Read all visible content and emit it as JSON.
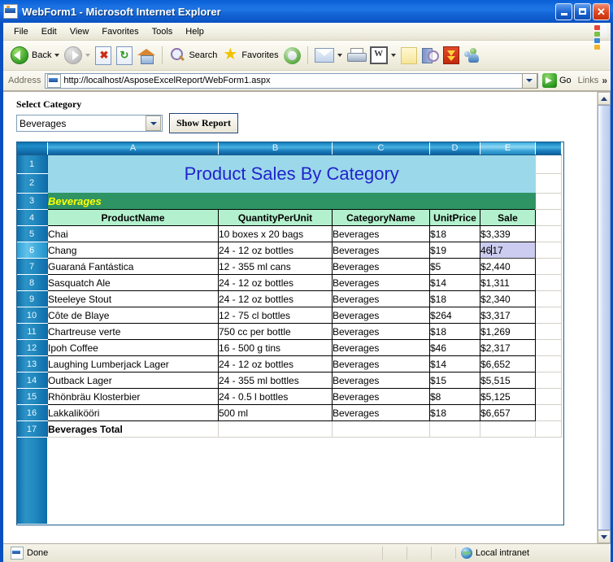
{
  "window": {
    "title": "WebForm1 - Microsoft Internet Explorer",
    "icon": "ie-document-icon",
    "buttons": {
      "minimize": "_",
      "maximize": "□",
      "close": "✕"
    }
  },
  "menubar": {
    "items": [
      {
        "label": "File"
      },
      {
        "label": "Edit"
      },
      {
        "label": "View"
      },
      {
        "label": "Favorites"
      },
      {
        "label": "Tools"
      },
      {
        "label": "Help"
      }
    ]
  },
  "toolbar": {
    "items": [
      {
        "name": "back-button",
        "label": "Back",
        "icon": "back-arrow-icon",
        "has_caret": true,
        "enabled": true
      },
      {
        "name": "forward-button",
        "label": "",
        "icon": "forward-arrow-icon",
        "has_caret": true,
        "enabled": false
      },
      {
        "name": "stop-button",
        "label": "",
        "icon": "stop-icon"
      },
      {
        "name": "refresh-button",
        "label": "",
        "icon": "refresh-icon"
      },
      {
        "name": "home-button",
        "label": "",
        "icon": "home-icon"
      },
      {
        "name": "search-button",
        "label": "Search",
        "icon": "search-icon"
      },
      {
        "name": "favorites-button",
        "label": "Favorites",
        "icon": "star-icon"
      },
      {
        "name": "media-button",
        "label": "",
        "icon": "media-icon"
      },
      {
        "name": "mail-button",
        "label": "",
        "icon": "mail-icon",
        "has_caret": true
      },
      {
        "name": "print-button",
        "label": "",
        "icon": "print-icon"
      },
      {
        "name": "edit-word-button",
        "label": "",
        "icon": "word-edit-icon",
        "has_caret": true
      },
      {
        "name": "notes-button",
        "label": "",
        "icon": "note-icon"
      },
      {
        "name": "research-button",
        "label": "",
        "icon": "research-icon"
      },
      {
        "name": "download-button",
        "label": "",
        "icon": "download-icon"
      },
      {
        "name": "messenger-button",
        "label": "",
        "icon": "messenger-icon"
      }
    ]
  },
  "address": {
    "label": "Address",
    "url": "http://localhost/AsposeExcelReport/WebForm1.aspx",
    "go_label": "Go",
    "links_label": "Links",
    "overflow_glyph": "»"
  },
  "page": {
    "form": {
      "select_label": "Select Category",
      "category_value": "Beverages",
      "show_report_label": "Show Report"
    },
    "sheet": {
      "column_headers": [
        "A",
        "B",
        "C",
        "D",
        "E"
      ],
      "selected_column": "E",
      "selected_row": 6,
      "row_numbers": [
        1,
        2,
        3,
        4,
        5,
        6,
        7,
        8,
        9,
        10,
        11,
        12,
        13,
        14,
        15,
        16,
        17
      ],
      "title": "Product Sales By Category",
      "category_header": "Beverages",
      "table_headers": [
        "ProductName",
        "QuantityPerUnit",
        "CategoryName",
        "UnitPrice",
        "Sale"
      ],
      "rows": [
        {
          "row": 5,
          "ProductName": "Chai",
          "QuantityPerUnit": "10 boxes x 20 bags",
          "CategoryName": "Beverages",
          "UnitPrice": "$18",
          "Sale": "$3,339"
        },
        {
          "row": 6,
          "ProductName": "Chang",
          "QuantityPerUnit": "24 - 12 oz bottles",
          "CategoryName": "Beverages",
          "UnitPrice": "$19",
          "Sale": "4617",
          "editing": true,
          "caret_after": 2
        },
        {
          "row": 7,
          "ProductName": "Guaraná Fantástica",
          "QuantityPerUnit": "12 - 355 ml cans",
          "CategoryName": "Beverages",
          "UnitPrice": "$5",
          "Sale": "$2,440"
        },
        {
          "row": 8,
          "ProductName": "Sasquatch Ale",
          "QuantityPerUnit": "24 - 12 oz bottles",
          "CategoryName": "Beverages",
          "UnitPrice": "$14",
          "Sale": "$1,311"
        },
        {
          "row": 9,
          "ProductName": "Steeleye Stout",
          "QuantityPerUnit": "24 - 12 oz bottles",
          "CategoryName": "Beverages",
          "UnitPrice": "$18",
          "Sale": "$2,340"
        },
        {
          "row": 10,
          "ProductName": "Côte de Blaye",
          "QuantityPerUnit": "12 - 75 cl bottles",
          "CategoryName": "Beverages",
          "UnitPrice": "$264",
          "Sale": "$3,317"
        },
        {
          "row": 11,
          "ProductName": "Chartreuse verte",
          "QuantityPerUnit": "750 cc per bottle",
          "CategoryName": "Beverages",
          "UnitPrice": "$18",
          "Sale": "$1,269"
        },
        {
          "row": 12,
          "ProductName": "Ipoh Coffee",
          "QuantityPerUnit": "16 - 500 g tins",
          "CategoryName": "Beverages",
          "UnitPrice": "$46",
          "Sale": "$2,317"
        },
        {
          "row": 13,
          "ProductName": "Laughing Lumberjack Lager",
          "QuantityPerUnit": "24 - 12 oz bottles",
          "CategoryName": "Beverages",
          "UnitPrice": "$14",
          "Sale": "$6,652"
        },
        {
          "row": 14,
          "ProductName": "Outback Lager",
          "QuantityPerUnit": "24 - 355 ml bottles",
          "CategoryName": "Beverages",
          "UnitPrice": "$15",
          "Sale": "$5,515"
        },
        {
          "row": 15,
          "ProductName": "Rhönbräu Klosterbier",
          "QuantityPerUnit": "24 - 0.5 l bottles",
          "CategoryName": "Beverages",
          "UnitPrice": "$8",
          "Sale": "$5,125"
        },
        {
          "row": 16,
          "ProductName": "Lakkalikööri",
          "QuantityPerUnit": "500 ml",
          "CategoryName": "Beverages",
          "UnitPrice": "$18",
          "Sale": "$6,657"
        }
      ],
      "total_row": {
        "row": 17,
        "label": "Beverages Total",
        "QuantityPerUnit": "",
        "CategoryName": "",
        "UnitPrice": "",
        "Sale": ""
      }
    }
  },
  "statusbar": {
    "status": "Done",
    "zone": "Local intranet"
  },
  "colors": {
    "title_bar": "#1e73e3",
    "sheet_title_bg": "#9bd9ea",
    "sheet_title_fg": "#2222cc",
    "category_bg": "#2e9464",
    "category_fg": "#ffff00",
    "header_bg": "#b3f0cd",
    "selection_bg": "#ccccf0",
    "col_header_bg": "#1f8ec9"
  }
}
